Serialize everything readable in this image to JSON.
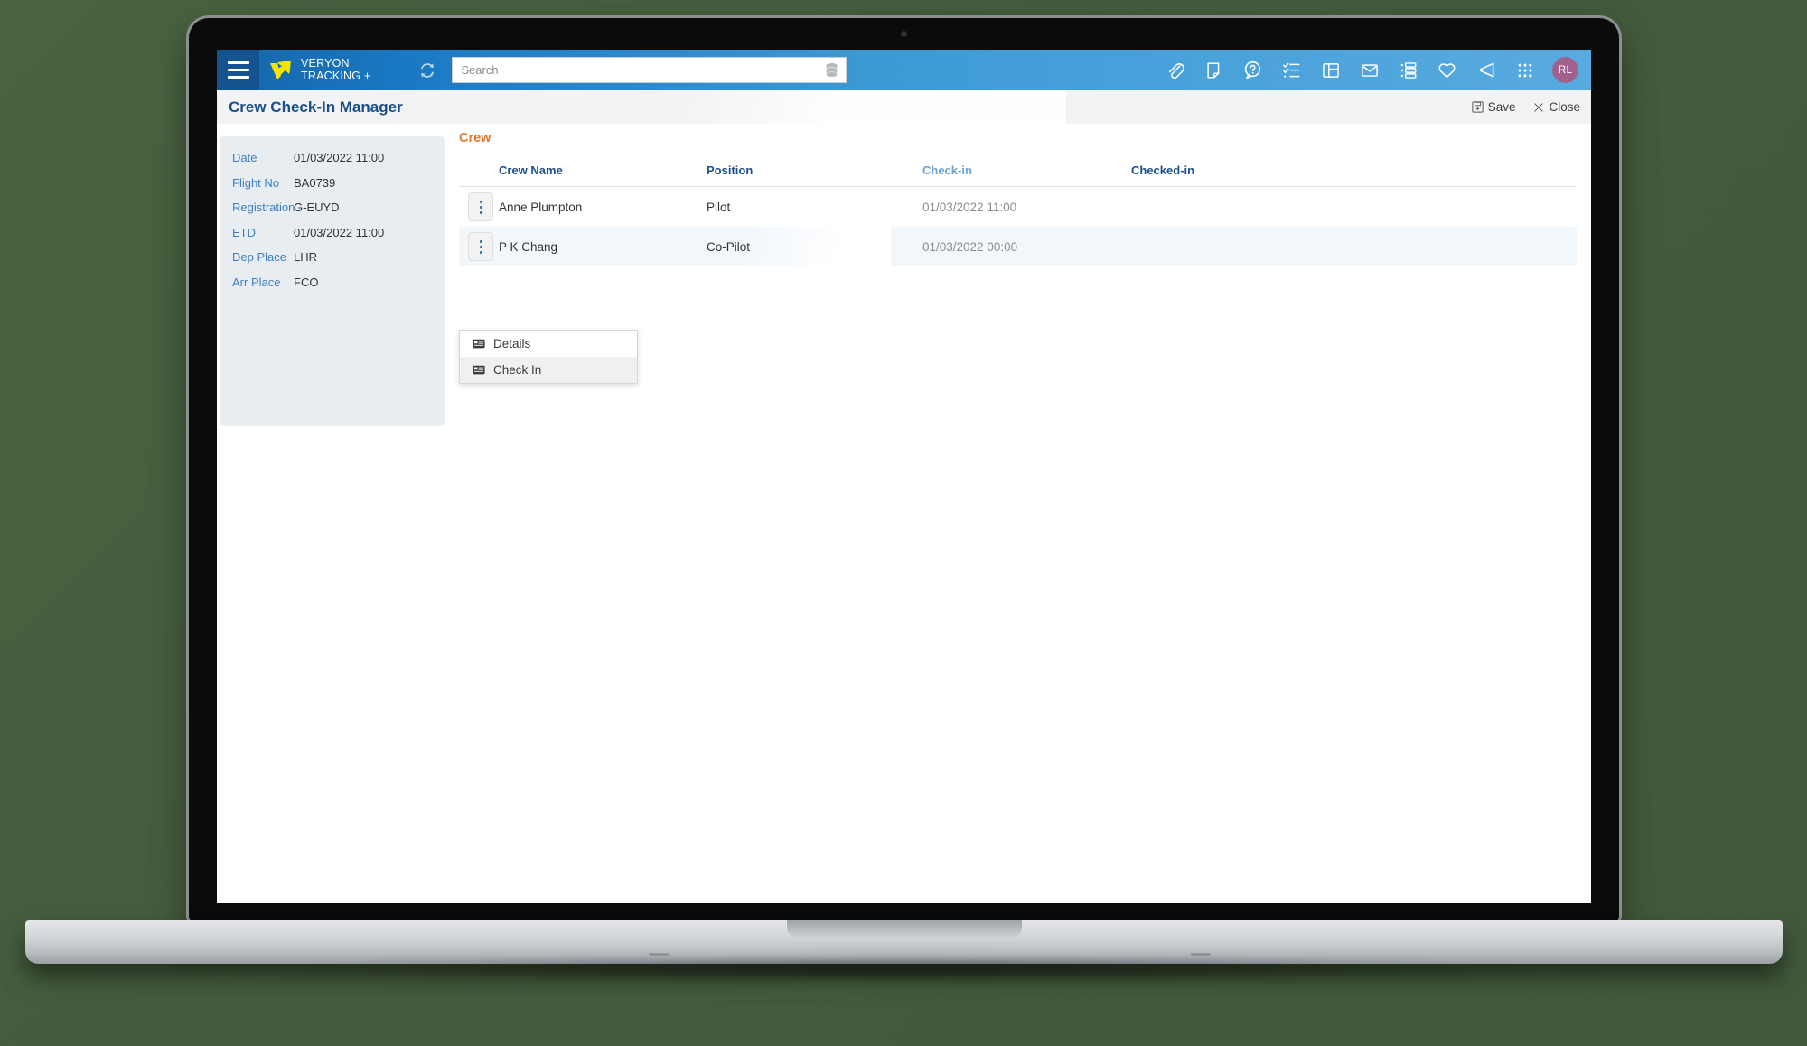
{
  "topbar": {
    "menu_icon": "hamburger-icon",
    "brand_line1": "VERYON",
    "brand_line2": "TRACKING +",
    "refresh_icon": "refresh-icon",
    "search_placeholder": "Search",
    "search_value": "",
    "database_icon": "database-icon",
    "icons": [
      {
        "name": "attachment-icon",
        "label": "Attachments"
      },
      {
        "name": "note-icon",
        "label": "Notes"
      },
      {
        "name": "help-icon",
        "label": "Help"
      },
      {
        "name": "checklist-icon",
        "label": "Tasks"
      },
      {
        "name": "layout-icon",
        "label": "Dashboard"
      },
      {
        "name": "mail-icon",
        "label": "Messages"
      },
      {
        "name": "list-icon",
        "label": "Queue"
      },
      {
        "name": "heart-icon",
        "label": "Favourites"
      },
      {
        "name": "megaphone-icon",
        "label": "Announcements"
      },
      {
        "name": "apps-grid-icon",
        "label": "Apps"
      }
    ],
    "avatar_initials": "RL",
    "avatar_color": "#a2618c",
    "bar_color_left": "#14538f",
    "bar_color_right": "#58abdf"
  },
  "page": {
    "title": "Crew Check-In Manager",
    "title_color": "#1b4f8c",
    "save_label": "Save",
    "close_label": "Close"
  },
  "flight": {
    "rows": [
      {
        "label": "Date",
        "value": "01/03/2022 11:00"
      },
      {
        "label": "Flight No",
        "value": "BA0739"
      },
      {
        "label": "Registration",
        "value": "G-EUYD"
      },
      {
        "label": "ETD",
        "value": "01/03/2022 11:00"
      },
      {
        "label": "Dep Place",
        "value": "LHR"
      },
      {
        "label": "Arr Place",
        "value": "FCO"
      }
    ],
    "label_color": "#3f7fbf",
    "panel_color": "#e8edf2"
  },
  "crew": {
    "heading": "Crew",
    "heading_color": "#e8762c",
    "columns": [
      {
        "label": "Crew Name",
        "color": "#1b4f8c"
      },
      {
        "label": "Position",
        "color": "#1b4f8c"
      },
      {
        "label": "Check-in",
        "color": "#6fa3cf"
      },
      {
        "label": "Checked-in",
        "color": "#1b4f8c"
      }
    ],
    "rows": [
      {
        "handle_icon": "kebab-menu-icon",
        "name": "Anne Plumpton",
        "position": "Pilot",
        "checkin": "01/03/2022 11:00",
        "checked_in": "",
        "selected": false
      },
      {
        "handle_icon": "kebab-menu-icon",
        "name": "P K Chang",
        "position": "Co-Pilot",
        "checkin": "01/03/2022 00:00",
        "checked_in": "",
        "selected": true
      }
    ]
  },
  "context_menu": {
    "items": [
      {
        "label": "Details",
        "icon": "id-card-icon",
        "hover": false
      },
      {
        "label": "Check In",
        "icon": "id-card-icon",
        "hover": true
      }
    ]
  }
}
